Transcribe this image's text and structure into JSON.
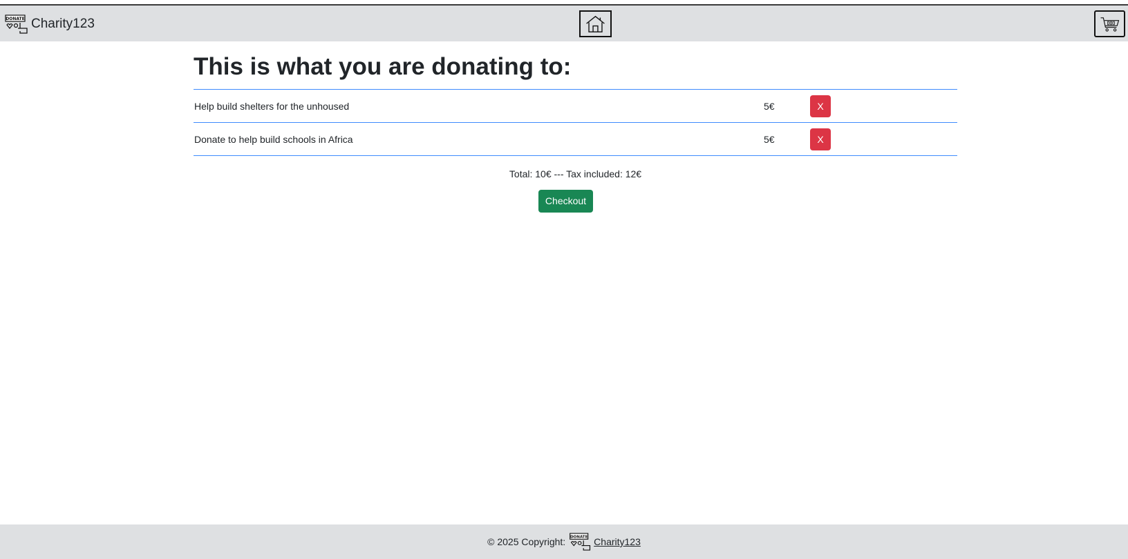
{
  "navbar": {
    "brand_text": "Charity123",
    "logo_text": "DONATE",
    "home_icon": "home-icon",
    "cart_icon": "shopping-cart-icon"
  },
  "main": {
    "title": "This is what you are donating to:",
    "items": [
      {
        "name": "Help build shelters for the unhoused",
        "price": "5€",
        "remove_label": "X"
      },
      {
        "name": "Donate to help build schools in Africa",
        "price": "5€",
        "remove_label": "X"
      }
    ],
    "summary": "Total: 10€ --- Tax included: 12€",
    "checkout_label": "Checkout"
  },
  "footer": {
    "copyright": "© 2025 Copyright:",
    "link_text": "Charity123",
    "logo_text": "DONATE"
  },
  "colors": {
    "navbar_bg": "#dee0e2",
    "divider": "#3d8bfd",
    "remove_button": "#dc3545",
    "checkout_button": "#198754"
  }
}
